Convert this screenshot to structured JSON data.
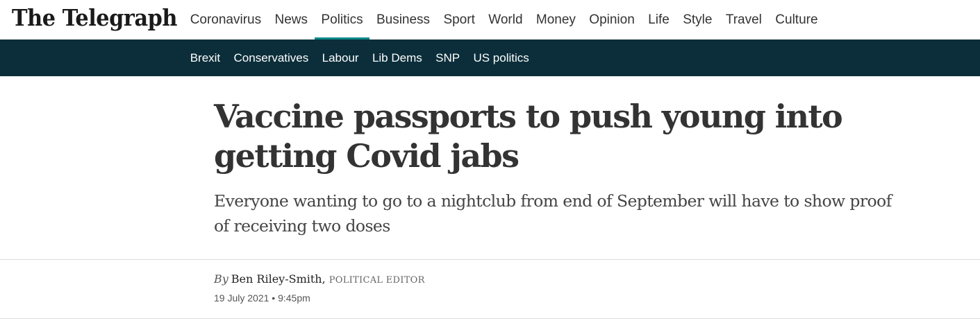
{
  "logo": {
    "text": "The Telegraph"
  },
  "main_nav": {
    "items": [
      {
        "label": "Coronavirus",
        "active": false
      },
      {
        "label": "News",
        "active": false
      },
      {
        "label": "Politics",
        "active": true
      },
      {
        "label": "Business",
        "active": false
      },
      {
        "label": "Sport",
        "active": false
      },
      {
        "label": "World",
        "active": false
      },
      {
        "label": "Money",
        "active": false
      },
      {
        "label": "Opinion",
        "active": false
      },
      {
        "label": "Life",
        "active": false
      },
      {
        "label": "Style",
        "active": false
      },
      {
        "label": "Travel",
        "active": false
      },
      {
        "label": "Culture",
        "active": false
      }
    ]
  },
  "sub_nav": {
    "items": [
      {
        "label": "Brexit"
      },
      {
        "label": "Conservatives"
      },
      {
        "label": "Labour"
      },
      {
        "label": "Lib Dems"
      },
      {
        "label": "SNP"
      },
      {
        "label": "US politics"
      }
    ]
  },
  "article": {
    "headline": "Vaccine passports to push young into getting Covid jabs",
    "standfirst": "Everyone wanting to go to a nightclub from end of September will have to show proof of receiving two doses",
    "byline": {
      "prefix": "By",
      "author": "Ben Riley-Smith,",
      "role": "POLITICAL EDITOR"
    },
    "dateline": "19 July 2021 • 9:45pm"
  },
  "colors": {
    "subnav_bg": "#0b2e3a",
    "active_underline": "#0d8a8a",
    "text": "#333333"
  }
}
